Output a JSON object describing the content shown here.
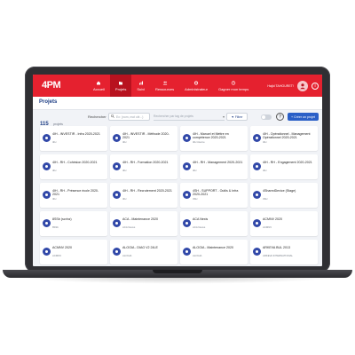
{
  "app": {
    "logo": "4PM",
    "nav": [
      {
        "label": "Accueil",
        "icon": "home-icon",
        "active": false
      },
      {
        "label": "Projets",
        "icon": "folder-icon",
        "active": true
      },
      {
        "label": "Suivi",
        "icon": "chart-icon",
        "active": false
      },
      {
        "label": "Ressources",
        "icon": "people-icon",
        "active": false
      },
      {
        "label": "Administrateur",
        "icon": "gear-icon",
        "active": false
      },
      {
        "label": "Gagner mon temps",
        "icon": "clock-icon",
        "active": false
      }
    ],
    "user": "Hajid TAHOURET!"
  },
  "page": {
    "title": "Projets",
    "count": "115",
    "count_label": "projets",
    "search_label": "Rechercher",
    "search_placeholder": "Ex: (nom, mot clé...)",
    "tag_placeholder": "Rechercher par tag de projets",
    "filter_label": "Filtrer",
    "create_label": "Créer un projet",
    "help": "?"
  },
  "projects": [
    {
      "title": "4IH - INVESTIR - Infra 2020-2021",
      "sub": "4IH"
    },
    {
      "title": "4IH - INVESTIR - Méthode 2020-2021",
      "sub": "4IH"
    },
    {
      "title": "4IH - Manuel et Mettre en compétence 2020-2021",
      "sub": "4IH interne"
    },
    {
      "title": "4IH - Opérationnel - Management Opérationnel 2020-2021",
      "sub": "4IH"
    },
    {
      "title": "4IH - RH - Cohésion 2020-2021",
      "sub": "4IH"
    },
    {
      "title": "4IH - RH - Formation 2020-2021",
      "sub": "4IH"
    },
    {
      "title": "4IH - RH - Management 2020-2021",
      "sub": "4IH"
    },
    {
      "title": "4IH - RH - Engagement 2020-2021",
      "sub": "4IH"
    },
    {
      "title": "4IH - RH - Présence école 2020-2021",
      "sub": "4IH"
    },
    {
      "title": "4IH - RH - Recrutement 2020-2021",
      "sub": "4IH"
    },
    {
      "title": "4SH - SUPPORT - Outils & Infra 2020-2021",
      "sub": "4SH"
    },
    {
      "title": "4SharedDevice (Stage)",
      "sub": "4SH"
    },
    {
      "title": "8SSb (scrinz)",
      "sub": "8SSb"
    },
    {
      "title": "ACA - Maintenance 2020",
      "sub": "ACA Nexus"
    },
    {
      "title": "ACA Nexis",
      "sub": "ACA Nexus"
    },
    {
      "title": "ACMNV 2020",
      "sub": "ACMNV"
    },
    {
      "title": "ACMNV 2020",
      "sub": "ACMNV"
    },
    {
      "title": "ALOGIA - DIAG V2 24LE",
      "sub": "ALOGIA"
    },
    {
      "title": "ALOGIA - Maintenance 2020",
      "sub": "ALOGIA"
    },
    {
      "title": "ARKEVA BUL 2013",
      "sub": "ARKEVA INTERNATIONAL"
    },
    {
      "title": "PROJET ARKIVA 2018",
      "sub": "ARKIVA INTERNATIONAL"
    },
    {
      "title": "ARKHE - Billonnet",
      "sub": "ARKHE INTERNATIONAL"
    },
    {
      "title": "ARKHE - Rolvampl",
      "sub": "ARKHE INTERNATIONAL"
    },
    {
      "title": "ARKHE - SOLITIEN 2020",
      "sub": "ARKHE INTERNATIONAL"
    }
  ],
  "colors": {
    "brand_red": "#e5212f",
    "active_nav": "#b8121f",
    "primary_blue": "#2a5fc7",
    "title_navy": "#1f3f86"
  }
}
